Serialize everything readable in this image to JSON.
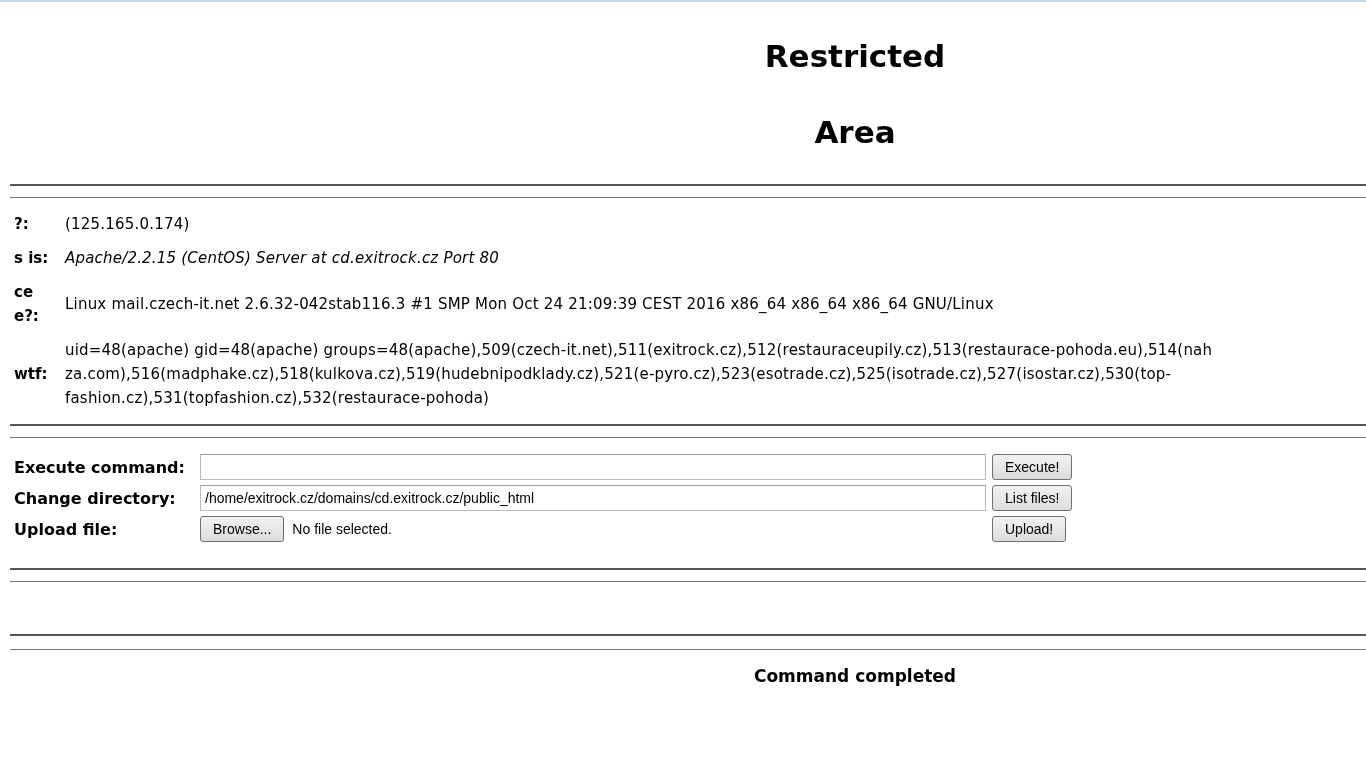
{
  "title_lines": [
    "Restricted",
    "Area"
  ],
  "info_rows": [
    {
      "label_lines": [
        "?:"
      ],
      "value_lines": [
        "(125.165.0.174)"
      ],
      "italic": false
    },
    {
      "label_lines": [
        "s is:"
      ],
      "value_lines": [
        "Apache/2.2.15 (CentOS) Server at cd.exitrock.cz Port 80"
      ],
      "italic": true
    },
    {
      "label_lines": [
        "ce",
        "e?:"
      ],
      "value_lines": [
        "Linux mail.czech-it.net 2.6.32-042stab116.3 #1 SMP Mon Oct 24 21:09:39 CEST 2016 x86_64 x86_64 x86_64 GNU/Linux"
      ],
      "italic": false
    },
    {
      "label_lines": [
        "wtf:"
      ],
      "value_lines": [
        "uid=48(apache) gid=48(apache) groups=48(apache),509(czech-it.net),511(exitrock.cz),512(restauraceupily.cz),513(restaurace-pohoda.eu),514(nah",
        "za.com),516(madphake.cz),518(kulkova.cz),519(hudebnipodklady.cz),521(e-pyro.cz),523(esotrade.cz),525(isotrade.cz),527(isostar.cz),530(top-",
        "fashion.cz),531(topfashion.cz),532(restaurace-pohoda)"
      ],
      "italic": false
    }
  ],
  "form_rows": [
    {
      "kind": "text",
      "label": "Execute command:",
      "value": "",
      "button": "Execute!"
    },
    {
      "kind": "text",
      "label": "Change directory:",
      "value": "/home/exitrock.cz/domains/cd.exitrock.cz/public_html",
      "button": "List files!"
    },
    {
      "kind": "file",
      "label": "Upload file:",
      "browse": "Browse...",
      "file_status": "No file selected.",
      "button": "Upload!"
    }
  ],
  "status": "Command completed"
}
